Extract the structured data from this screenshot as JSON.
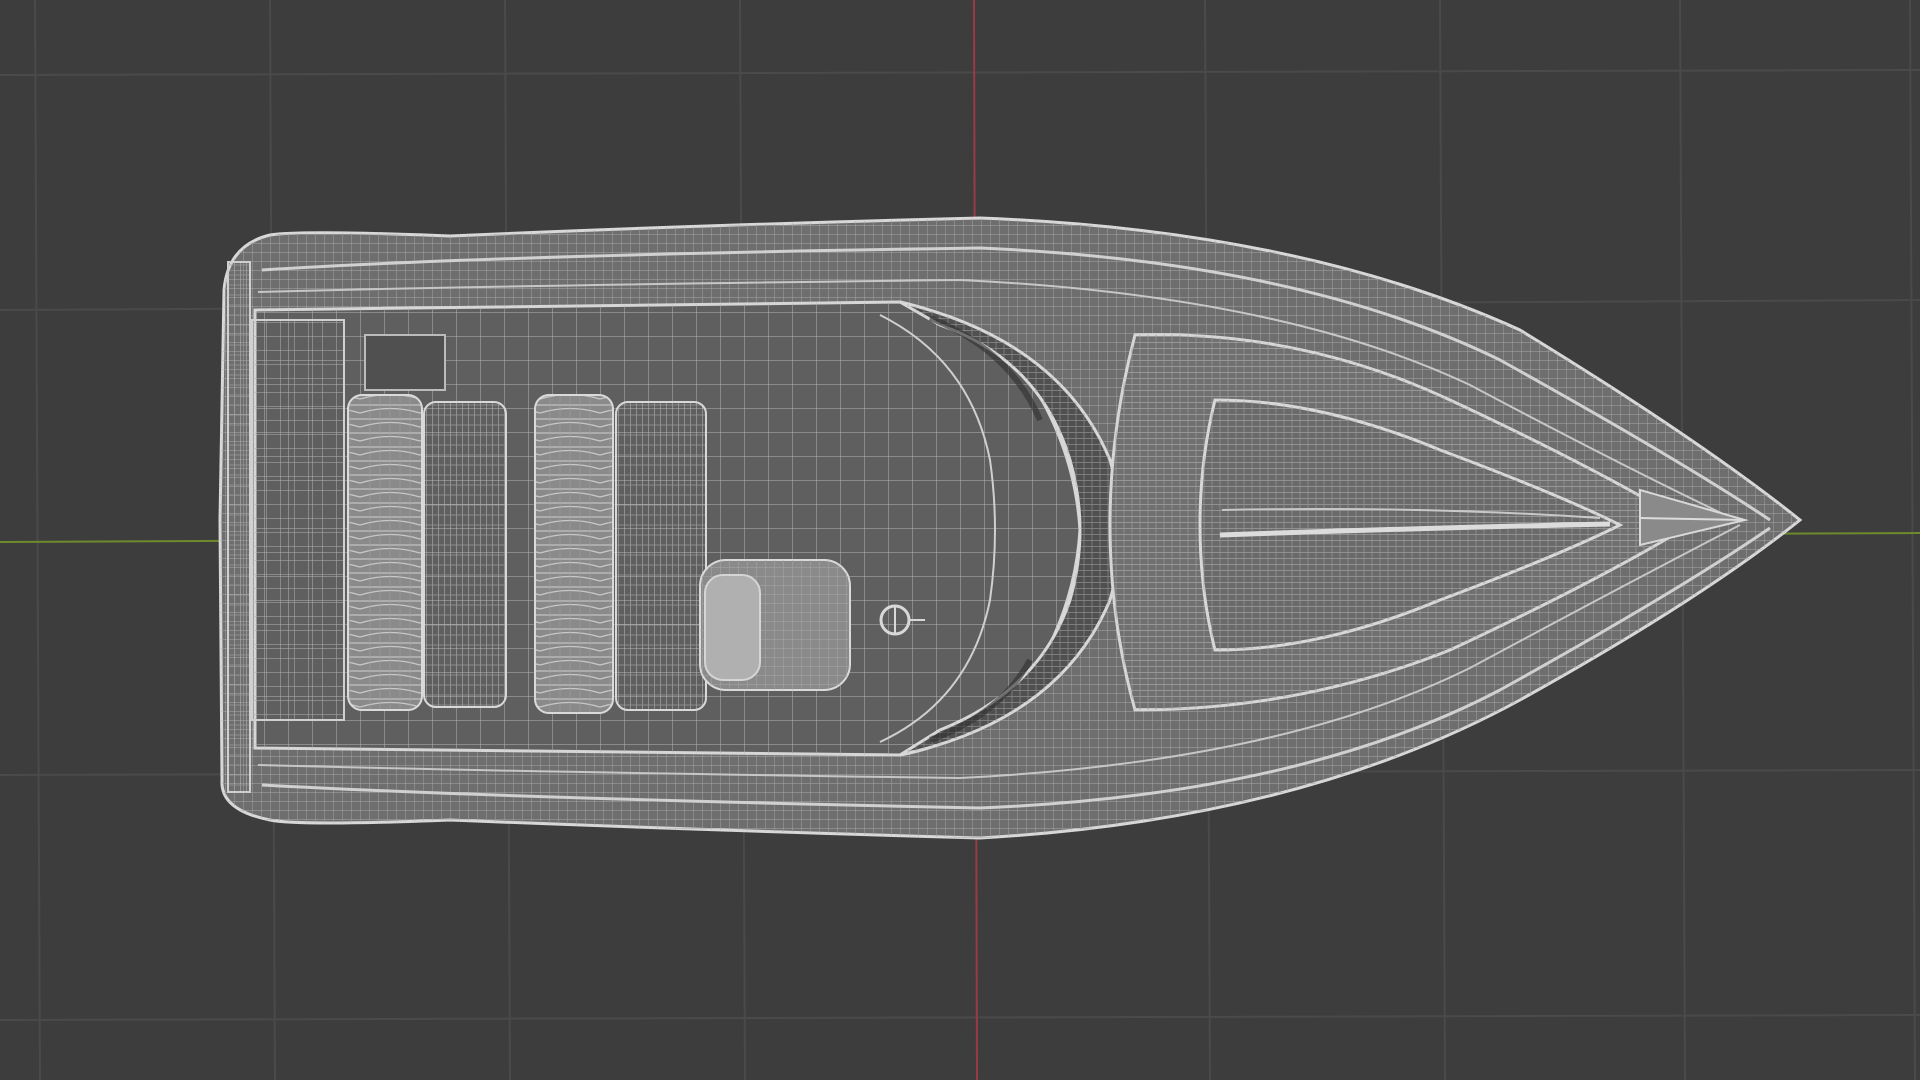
{
  "viewport": {
    "background_color": "#3d3d3d",
    "grid_color": "#4a4a4a",
    "x_axis_color": "#6f8a2c",
    "y_axis_color": "#9a3a45",
    "wire_color": "#bdbdbd",
    "shade_color": "#7a7a7a"
  },
  "scene": {
    "object_name": "boat-wireframe",
    "view": "top"
  }
}
